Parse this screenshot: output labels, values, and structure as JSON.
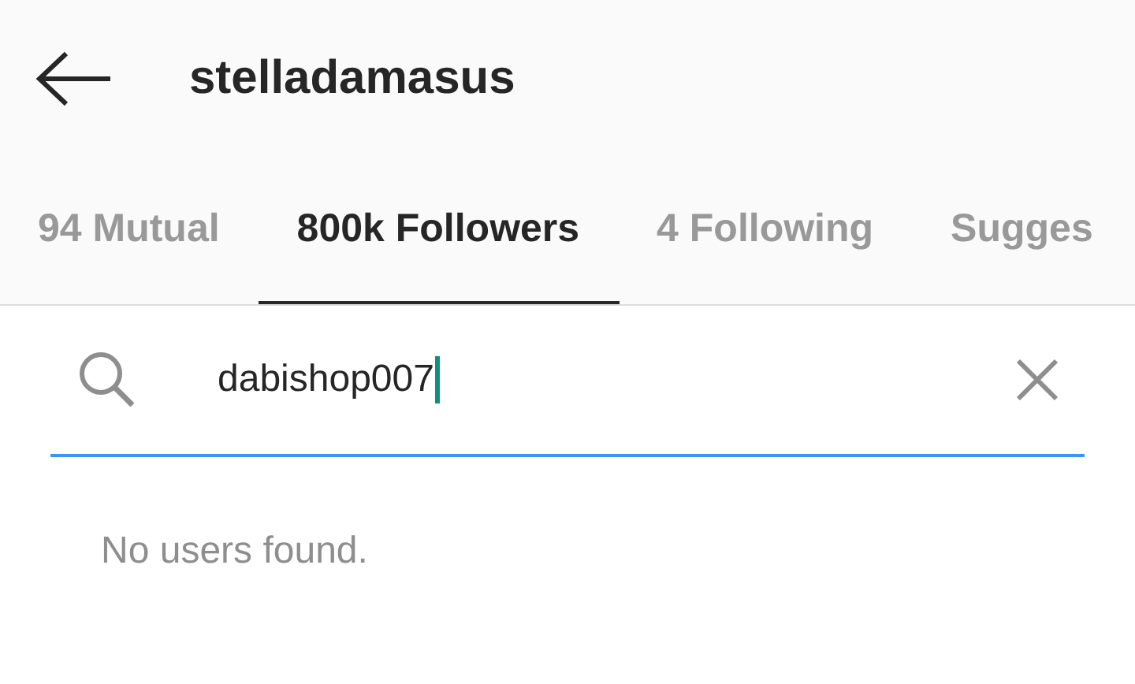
{
  "header": {
    "title": "stelladamasus"
  },
  "tabs": [
    {
      "label": "94 Mutual",
      "selected": false
    },
    {
      "label": "800k Followers",
      "selected": true
    },
    {
      "label": "4 Following",
      "selected": false
    },
    {
      "label": "Sugges",
      "selected": false
    }
  ],
  "search": {
    "value": "dabishop007",
    "focused": true
  },
  "message": "No users found."
}
